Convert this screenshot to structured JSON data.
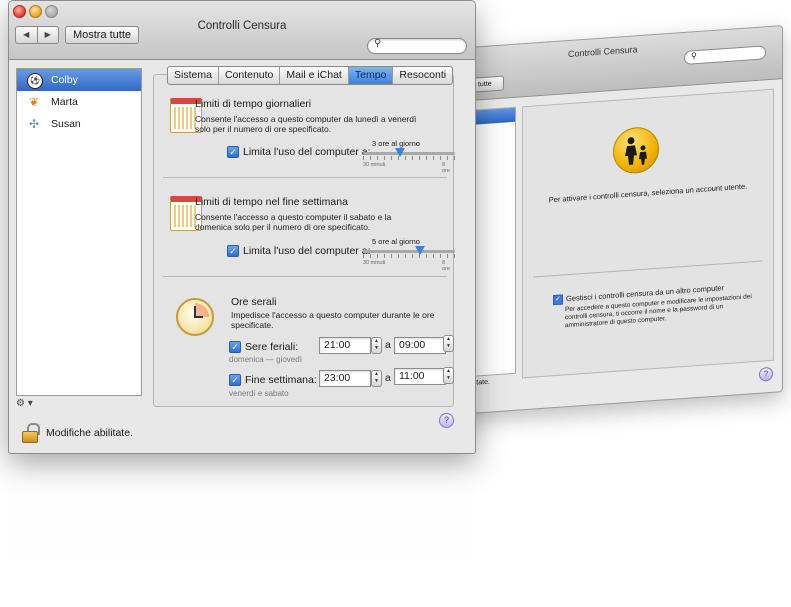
{
  "front_window": {
    "title": "Controlli Censura",
    "nav_back": "◀",
    "nav_forward": "▶",
    "show_all": "Mostra tutte",
    "search_placeholder": "",
    "users": [
      {
        "name": "Colby",
        "icon": "soccer-ball-icon",
        "selected": true
      },
      {
        "name": "Marta",
        "icon": "butterfly-icon",
        "selected": false
      },
      {
        "name": "Susan",
        "icon": "dragonfly-icon",
        "selected": false
      }
    ],
    "gear_menu": "⚙ ▾",
    "tabs": [
      {
        "label": "Sistema",
        "active": false
      },
      {
        "label": "Contenuto",
        "active": false
      },
      {
        "label": "Mail e iChat",
        "active": false
      },
      {
        "label": "Tempo",
        "active": true
      },
      {
        "label": "Resoconti",
        "active": false
      }
    ],
    "weekday": {
      "title": "Limiti di tempo giornalieri",
      "desc": "Consente l'accesso a questo computer da lunedì a venerdì solo per il numero di ore specificato.",
      "check_label": "Limita l'uso del computer a:",
      "checked": true,
      "slider_value_label": "3 ore al giorno",
      "slider_min": "30 minuti",
      "slider_max": "8 ore",
      "slider_fraction": 0.4
    },
    "weekend": {
      "title": "Limiti di tempo nel fine settimana",
      "desc": "Consente l'accesso a questo computer il sabato e la domenica solo per il numero di ore specificato.",
      "check_label": "Limita l'uso del computer a:",
      "checked": true,
      "slider_value_label": "5 ore al giorno",
      "slider_min": "30 minuti",
      "slider_max": "8 ore",
      "slider_fraction": 0.62
    },
    "bedtime": {
      "title": "Ore serali",
      "desc": "Impedisce l'accesso a questo computer durante le ore specificate.",
      "school_nights_label": "Sere feriali:",
      "school_nights_sub": "domenica — giovedì",
      "school_from": "21:00",
      "school_to": "09:00",
      "weekend_label": "Fine settimana:",
      "weekend_sub": "venerdì e sabato",
      "weekend_from": "23:00",
      "weekend_to": "11:00",
      "a_label": "a"
    },
    "help": "?",
    "lock_text": "Modifiche abilitate."
  },
  "back_window": {
    "title": "Controlli Censura",
    "show_all_partial": "stra tutte",
    "info": "Per attivare i controlli censura, seleziona un account utente.",
    "manage_label": "Gestisci i controlli censura da un altro computer",
    "manage_note": "Per accedere a questo computer e modificare le impostazioni dei controlli censura, ti occorre il nome e la password di un amministratore di questo computer.",
    "foot_partial": "e abilitate.",
    "help": "?"
  },
  "colors": {
    "accent": "#3b82e0",
    "selection": "#2f68c9",
    "window_bg": "#e8e8e8"
  }
}
